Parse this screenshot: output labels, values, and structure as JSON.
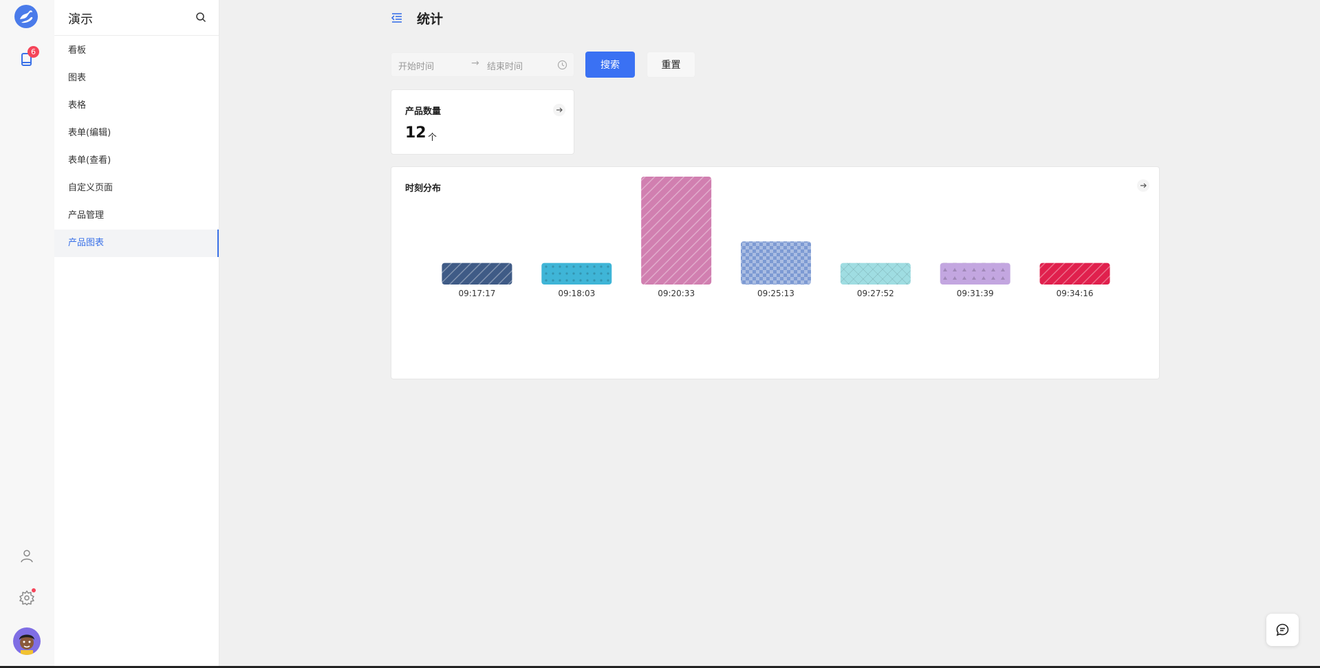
{
  "app": {
    "name": "演示",
    "colors": {
      "accent": "#3a71f3",
      "badge": "#f5455a",
      "active_nav": "#3a71e8"
    }
  },
  "rail": {
    "notifications_badge": "6",
    "icons": [
      "logo-icon",
      "book-icon",
      "user-icon",
      "gear-icon",
      "avatar"
    ]
  },
  "sidebar": {
    "title": "演示",
    "items": [
      {
        "label": "看板"
      },
      {
        "label": "图表"
      },
      {
        "label": "表格"
      },
      {
        "label": "表单(编辑)"
      },
      {
        "label": "表单(查看)"
      },
      {
        "label": "自定义页面"
      },
      {
        "label": "产品管理"
      },
      {
        "label": "产品图表",
        "active": true
      }
    ]
  },
  "header": {
    "title": "统计"
  },
  "filter": {
    "start_placeholder": "开始时间",
    "separator": "→",
    "end_placeholder": "结束时间",
    "search_label": "搜索",
    "reset_label": "重置"
  },
  "stat_card": {
    "title": "产品数量",
    "value": "12",
    "unit": "个"
  },
  "chart_card": {
    "title": "时刻分布"
  },
  "chart_data": {
    "type": "bar",
    "title": "时刻分布",
    "categories": [
      "09:17:17",
      "09:18:03",
      "09:20:33",
      "09:25:13",
      "09:27:52",
      "09:31:39",
      "09:34:16"
    ],
    "values": [
      1,
      1,
      5,
      2,
      1,
      1,
      1
    ],
    "colors": [
      "#3f5b86",
      "#3fb5d7",
      "#d17fb0",
      "#7d9ad3",
      "#9fdde2",
      "#c3a6e0",
      "#e0204d"
    ],
    "patterns": [
      "diagonal-lines",
      "dots",
      "diagonal-lines",
      "checker",
      "crosshatch",
      "triangles",
      "diagonal-lines"
    ],
    "xlabel": "",
    "ylabel": "",
    "grid": false,
    "legend": "none"
  }
}
